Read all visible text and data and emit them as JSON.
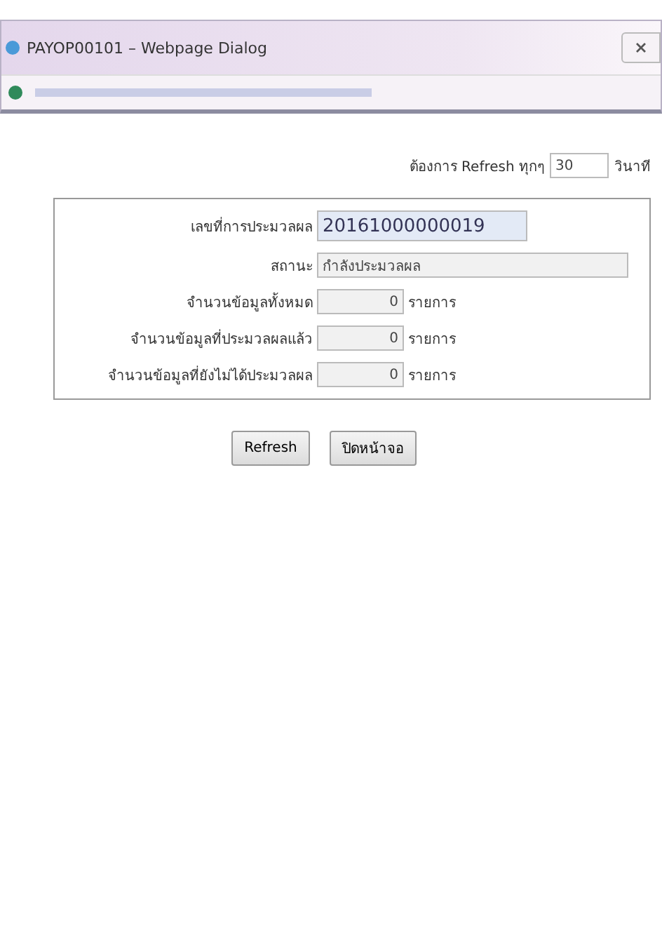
{
  "window": {
    "title": "PAYOP00101 – Webpage Dialog"
  },
  "refresh": {
    "label": "ต้องการ Refresh ทุกๆ",
    "value": "30",
    "unit": "วินาที"
  },
  "fields": [
    {
      "label": "เลขที่การประมวลผล",
      "value": "20161000000019",
      "kind": "highlight"
    },
    {
      "label": "สถานะ",
      "value": "กำลังประมวลผล",
      "kind": "wide"
    },
    {
      "label": "จำนวนข้อมูลทั้งหมด",
      "value": "0",
      "unit": "รายการ",
      "kind": "count"
    },
    {
      "label": "จำนวนข้อมูลที่ประมวลผลแล้ว",
      "value": "0",
      "unit": "รายการ",
      "kind": "count"
    },
    {
      "label": "จำนวนข้อมูลที่ยังไม่ได้ประมวลผล",
      "value": "0",
      "unit": "รายการ",
      "kind": "count"
    }
  ],
  "buttons": [
    "Refresh",
    "ปิดหน้าจอ"
  ]
}
